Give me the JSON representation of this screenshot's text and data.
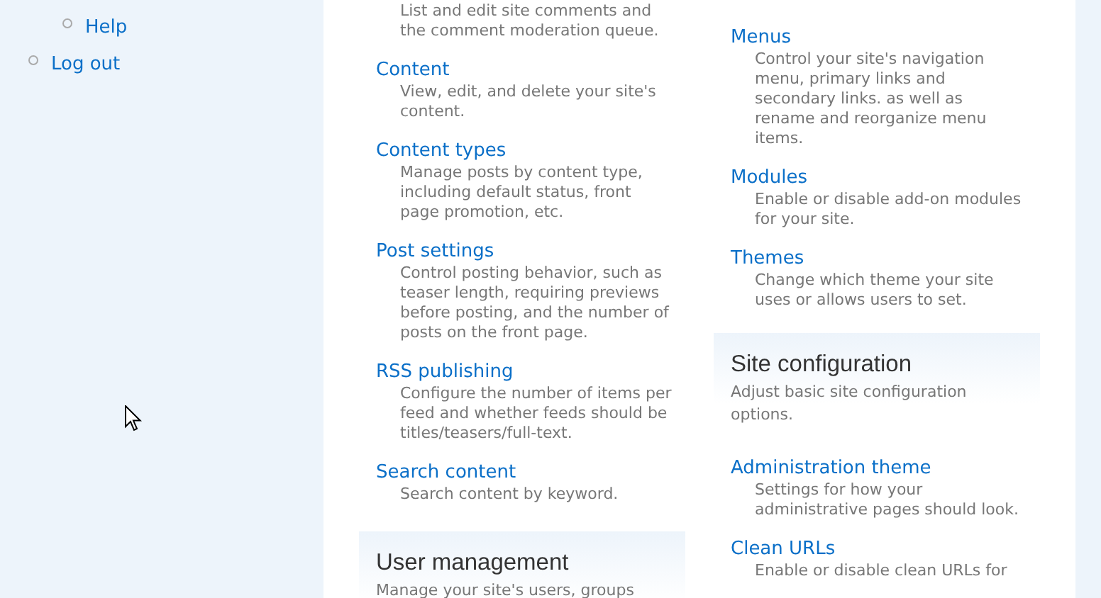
{
  "sidebar": {
    "sub_items": [
      {
        "label": "Help"
      }
    ],
    "items": [
      {
        "label": "Log out"
      }
    ]
  },
  "columns": [
    {
      "blocks": [
        {
          "kind": "list",
          "entries": [
            {
              "description": "List and edit site comments and the comment moderation queue."
            },
            {
              "title": "Content",
              "description": "View, edit, and delete your site's content."
            },
            {
              "title": "Content types",
              "description": "Manage posts by content type, including default status, front page promotion, etc."
            },
            {
              "title": "Post settings",
              "description": "Control posting behavior, such as teaser length, requiring previews before posting, and the number of posts on the front page."
            },
            {
              "title": "RSS publishing",
              "description": "Configure the number of items per feed and whether feeds should be titles/teasers/full-text."
            },
            {
              "title": "Search content",
              "description": "Search content by keyword."
            }
          ]
        },
        {
          "kind": "section",
          "title": "User management",
          "description": "Manage your site's users, groups"
        }
      ]
    },
    {
      "blocks": [
        {
          "kind": "list",
          "entries": [
            {
              "title": "Menus",
              "description": "Control your site's navigation menu, primary links and secondary links. as well as rename and reorganize menu items."
            },
            {
              "title": "Modules",
              "description": "Enable or disable add-on modules for your site."
            },
            {
              "title": "Themes",
              "description": "Change which theme your site uses or allows users to set."
            }
          ]
        },
        {
          "kind": "section",
          "title": "Site configuration",
          "description": "Adjust basic site configuration options.",
          "entries": [
            {
              "title": "Administration theme",
              "description": "Settings for how your administrative pages should look."
            },
            {
              "title": "Clean URLs",
              "description": "Enable or disable clean URLs for"
            }
          ]
        }
      ]
    }
  ]
}
